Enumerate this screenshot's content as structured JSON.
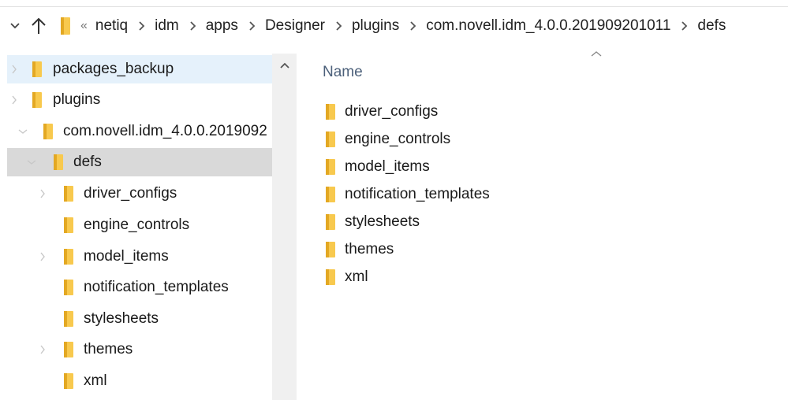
{
  "addressbar": {
    "overflow": "«",
    "crumbs": [
      "netiq",
      "idm",
      "apps",
      "Designer",
      "plugins",
      "com.novell.idm_4.0.0.201909201011",
      "defs"
    ]
  },
  "navpane": {
    "items": [
      {
        "label": "packages_backup"
      },
      {
        "label": "plugins"
      },
      {
        "label": "com.novell.idm_4.0.0.2019092"
      },
      {
        "label": "defs"
      },
      {
        "label": "driver_configs"
      },
      {
        "label": "engine_controls"
      },
      {
        "label": "model_items"
      },
      {
        "label": "notification_templates"
      },
      {
        "label": "stylesheets"
      },
      {
        "label": "themes"
      },
      {
        "label": "xml"
      }
    ]
  },
  "content": {
    "column_header": "Name",
    "files": [
      {
        "name": "driver_configs"
      },
      {
        "name": "engine_controls"
      },
      {
        "name": "model_items"
      },
      {
        "name": "notification_templates"
      },
      {
        "name": "stylesheets"
      },
      {
        "name": "themes"
      },
      {
        "name": "xml"
      }
    ]
  },
  "colors": {
    "folder": "#f8c94e",
    "folder_dark": "#e3a823",
    "hover": "#e5f1fb",
    "selected": "#d9d9d9",
    "header_text": "#4c607a"
  },
  "icons": {
    "folder": "folder-icon",
    "chevron_right": "chevron-right-icon",
    "chevron_down": "chevron-down-icon",
    "arrow_up": "arrow-up-icon"
  }
}
